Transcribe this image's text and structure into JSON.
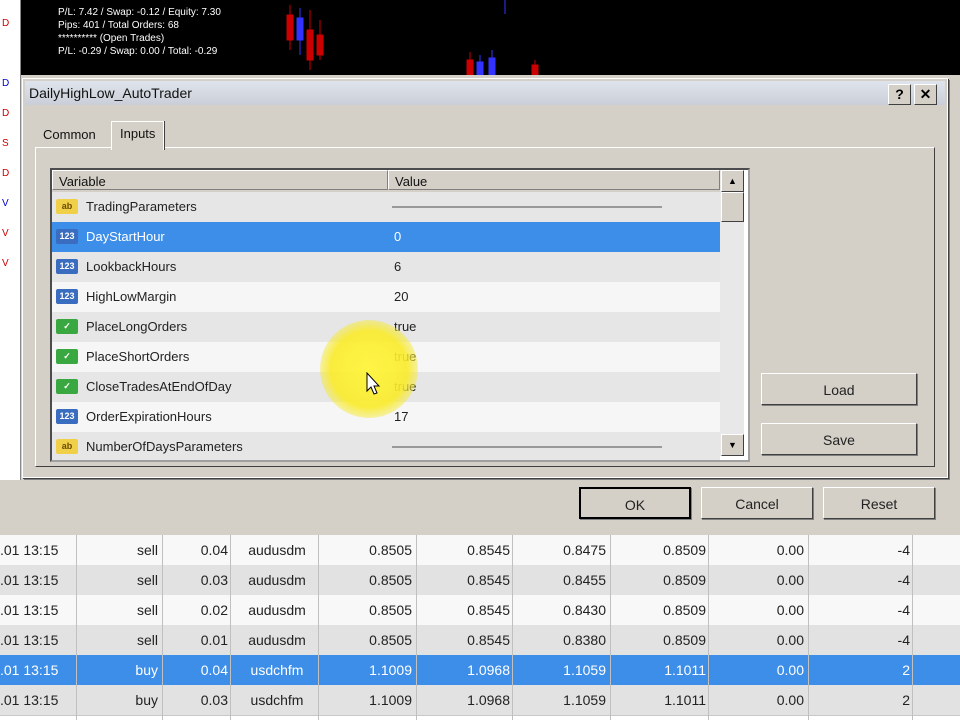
{
  "chart": {
    "overlay_lines": [
      "P/L: 7.42 / Swap: -0.12 / Equity: 7.30",
      "Pips: 401 / Total Orders: 68",
      "********** (Open Trades)",
      "P/L: -0.29 / Swap: 0.00 / Total: -0.29"
    ],
    "left_strip_marks": [
      "D",
      "D",
      "D",
      "S",
      "D",
      "V",
      "V",
      "V",
      "S"
    ]
  },
  "dialog": {
    "title": "DailyHighLow_AutoTrader",
    "help_label": "?",
    "close_label": "✕",
    "tabs": [
      "Common",
      "Inputs"
    ],
    "active_tab": "Inputs",
    "grid": {
      "columns": [
        "Variable",
        "Value"
      ],
      "rows": [
        {
          "icon": "abc",
          "name": "TradingParameters",
          "value": "",
          "separator": true
        },
        {
          "icon": "123",
          "name": "DayStartHour",
          "value": "0",
          "selected": true
        },
        {
          "icon": "123",
          "name": "LookbackHours",
          "value": "6"
        },
        {
          "icon": "123",
          "name": "HighLowMargin",
          "value": "20"
        },
        {
          "icon": "bool",
          "name": "PlaceLongOrders",
          "value": "true"
        },
        {
          "icon": "bool",
          "name": "PlaceShortOrders",
          "value": "true"
        },
        {
          "icon": "bool",
          "name": "CloseTradesAtEndOfDay",
          "value": "true"
        },
        {
          "icon": "123",
          "name": "OrderExpirationHours",
          "value": "17"
        },
        {
          "icon": "abc",
          "name": "NumberOfDaysParameters",
          "value": "",
          "separator": true
        }
      ]
    },
    "buttons": {
      "load": "Load",
      "save": "Save",
      "ok": "OK",
      "cancel": "Cancel",
      "reset": "Reset"
    }
  },
  "trades": [
    {
      "time": ".01 13:15",
      "type": "sell",
      "size": "0.04",
      "symbol": "audusdm",
      "price": "0.8505",
      "sl": "0.8545",
      "tp": "0.8475",
      "current": "0.8509",
      "swap": "0.00",
      "profit": "-4"
    },
    {
      "time": ".01 13:15",
      "type": "sell",
      "size": "0.03",
      "symbol": "audusdm",
      "price": "0.8505",
      "sl": "0.8545",
      "tp": "0.8455",
      "current": "0.8509",
      "swap": "0.00",
      "profit": "-4"
    },
    {
      "time": ".01 13:15",
      "type": "sell",
      "size": "0.02",
      "symbol": "audusdm",
      "price": "0.8505",
      "sl": "0.8545",
      "tp": "0.8430",
      "current": "0.8509",
      "swap": "0.00",
      "profit": "-4"
    },
    {
      "time": ".01 13:15",
      "type": "sell",
      "size": "0.01",
      "symbol": "audusdm",
      "price": "0.8505",
      "sl": "0.8545",
      "tp": "0.8380",
      "current": "0.8509",
      "swap": "0.00",
      "profit": "-4"
    },
    {
      "time": ".01 13:15",
      "type": "buy",
      "size": "0.04",
      "symbol": "usdchfm",
      "price": "1.1009",
      "sl": "1.0968",
      "tp": "1.1059",
      "current": "1.1011",
      "swap": "0.00",
      "profit": "2",
      "selected": true
    },
    {
      "time": ".01 13:15",
      "type": "buy",
      "size": "0.03",
      "symbol": "usdchfm",
      "price": "1.1009",
      "sl": "1.0968",
      "tp": "1.1059",
      "current": "1.1011",
      "swap": "0.00",
      "profit": "2"
    }
  ],
  "colors": {
    "selection": "#3d8ee8",
    "dialog_face": "#d4d0c8",
    "highlight": "#f5e840"
  }
}
